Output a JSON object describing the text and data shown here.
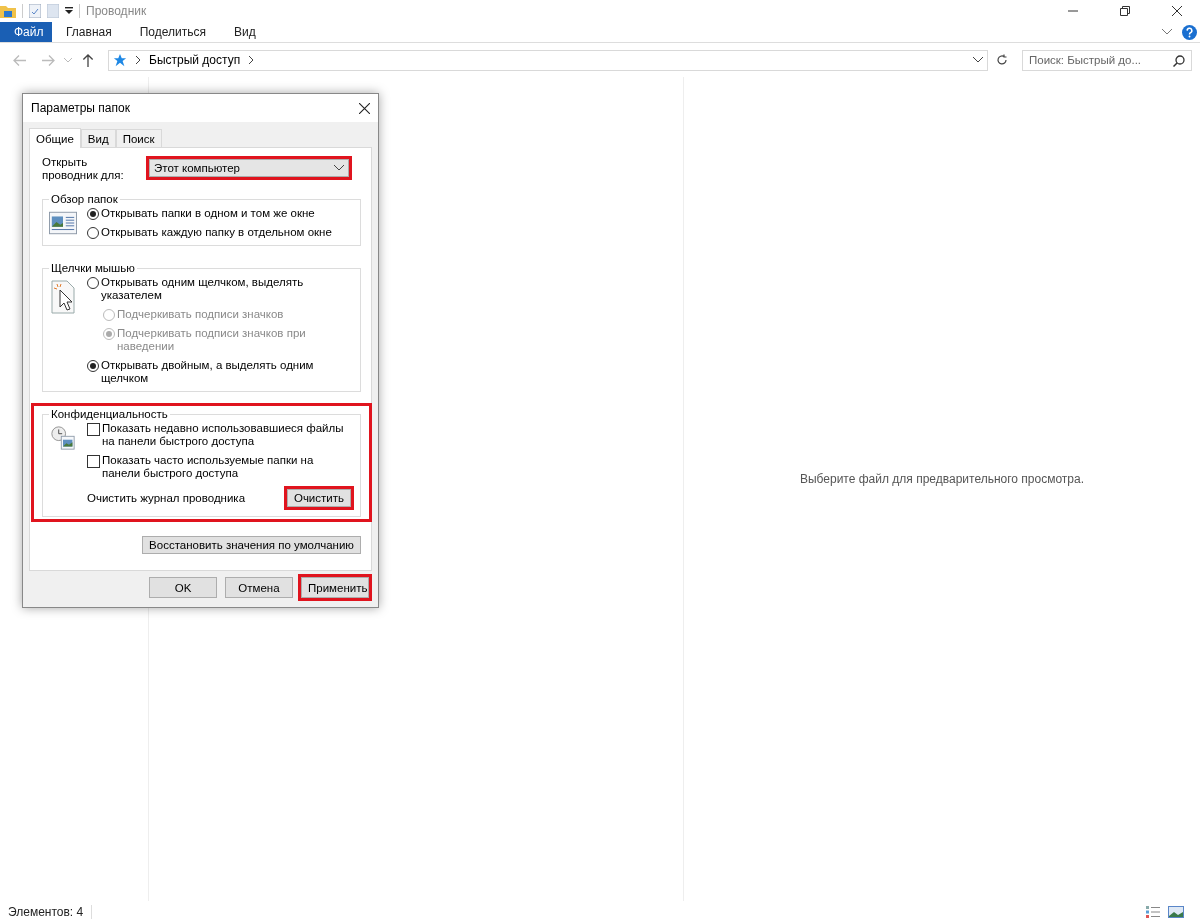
{
  "window": {
    "title": "Проводник"
  },
  "ribbon_tabs": [
    {
      "label": "Файл",
      "selected": true
    },
    {
      "label": "Главная",
      "selected": false
    },
    {
      "label": "Поделиться",
      "selected": false
    },
    {
      "label": "Вид",
      "selected": false
    }
  ],
  "address": {
    "crumbs": [
      "Быстрый доступ"
    ]
  },
  "search": {
    "placeholder": "Поиск: Быстрый до..."
  },
  "preview": {
    "message": "Выберите файл для предварительного просмотра."
  },
  "status_bar": {
    "items_count": "Элементов: 4"
  },
  "dialog": {
    "title": "Параметры папок",
    "tabs": [
      {
        "label": "Общие",
        "selected": true
      },
      {
        "label": "Вид",
        "selected": false
      },
      {
        "label": "Поиск",
        "selected": false
      }
    ],
    "open_in": {
      "label": "Открыть проводник для:",
      "value": "Этот компьютер",
      "highlighted": true
    },
    "groups": [
      {
        "title": "Обзор папок",
        "kind": "window",
        "highlighted": false,
        "options": [
          {
            "kind": "radio",
            "label": "Открывать папки в одном и том же окне",
            "checked": true,
            "disabled": false
          },
          {
            "kind": "radio",
            "label": "Открывать каждую папку в отдельном окне",
            "checked": false,
            "disabled": false
          }
        ]
      },
      {
        "title": "Щелчки мышью",
        "kind": "cursor",
        "highlighted": false,
        "options": [
          {
            "kind": "radio",
            "label": "Открывать одним щелчком, выделять указателем",
            "checked": false,
            "disabled": false,
            "children": [
              {
                "kind": "radio",
                "label": "Подчеркивать подписи значков",
                "checked": false,
                "disabled": true
              },
              {
                "kind": "radio",
                "label": "Подчеркивать подписи значков при наведении",
                "checked": true,
                "disabled": true
              }
            ]
          },
          {
            "kind": "radio",
            "label": "Открывать двойным, а выделять одним щелчком",
            "checked": true,
            "disabled": false
          }
        ]
      },
      {
        "title": "Конфиденциальность",
        "kind": "clock",
        "highlighted": true,
        "options": [
          {
            "kind": "checkbox",
            "label": "Показать недавно использовавшиеся файлы на панели быстрого доступа",
            "checked": false,
            "disabled": false
          },
          {
            "kind": "checkbox",
            "label": "Показать часто используемые папки на панели быстрого доступа",
            "checked": false,
            "disabled": false
          }
        ],
        "action": {
          "label": "Очистить журнал проводника",
          "button": "Очистить",
          "highlighted": true
        }
      }
    ],
    "restore_button": "Восстановить значения по умолчанию",
    "buttons": [
      {
        "label": "OK",
        "highlighted": false
      },
      {
        "label": "Отмена",
        "highlighted": false
      },
      {
        "label": "Применить",
        "highlighted": true
      }
    ]
  }
}
